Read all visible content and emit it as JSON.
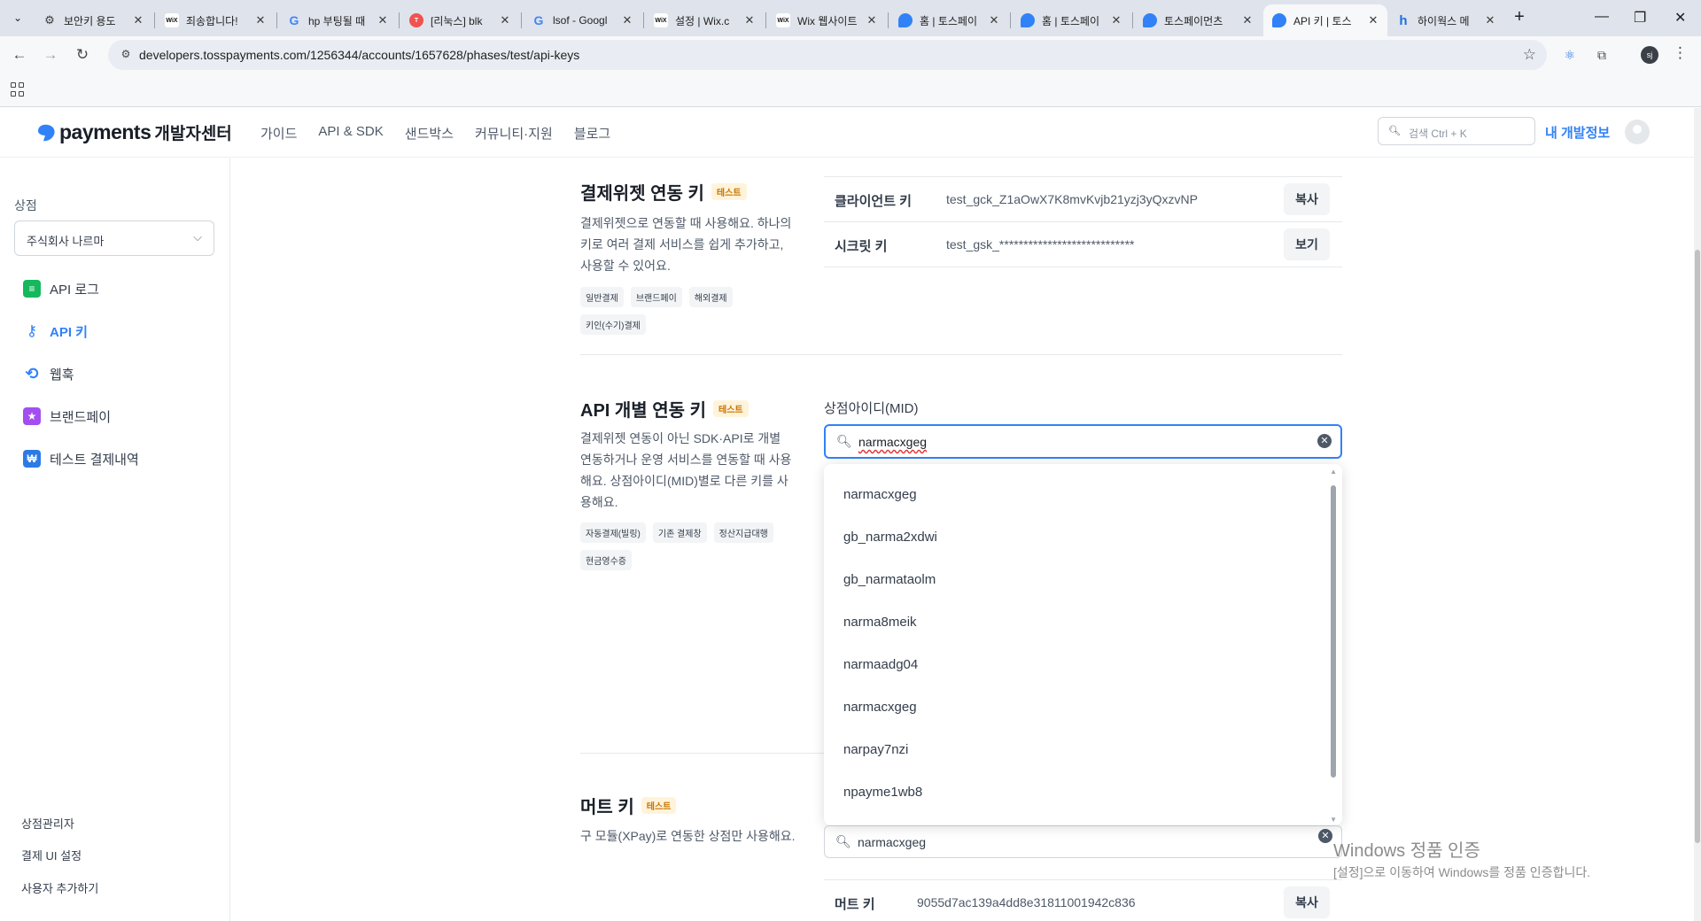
{
  "browser": {
    "tabs": [
      {
        "title": "보안키 용도",
        "icon": "gear-icon"
      },
      {
        "title": "죄송합니다!",
        "icon": "wix-icon"
      },
      {
        "title": "hp 부팅될 때",
        "icon": "google-icon"
      },
      {
        "title": "[리눅스] blk",
        "icon": "red-circle-icon"
      },
      {
        "title": "lsof - Googl",
        "icon": "google-icon"
      },
      {
        "title": "설정 | Wix.c",
        "icon": "wix-icon"
      },
      {
        "title": "Wix 웹사이트",
        "icon": "wix-icon"
      },
      {
        "title": "홈 | 토스페이",
        "icon": "toss-icon"
      },
      {
        "title": "홈 | 토스페이",
        "icon": "toss-icon"
      },
      {
        "title": "토스페이먼츠",
        "icon": "toss-icon"
      },
      {
        "title": "API 키 | 토스",
        "icon": "toss-icon"
      },
      {
        "title": "하이웍스 메",
        "icon": "hiworks-icon"
      }
    ],
    "active_tab_index": 10,
    "url": "developers.tosspayments.com/1256344/accounts/1657628/phases/test/api-keys",
    "profile_initials": "sj"
  },
  "header": {
    "logo_word": "payments",
    "logo_sub": "개발자센터",
    "nav": [
      "가이드",
      "API & SDK",
      "샌드박스",
      "커뮤니티·지원",
      "블로그"
    ],
    "search_placeholder": "검색 Ctrl + K",
    "my_dev": "내 개발정보"
  },
  "sidebar": {
    "store_label": "상점",
    "store_value": "주식회사 나르마",
    "items": [
      {
        "label": "API 로그",
        "icon": "document-icon",
        "color": "#15b85c"
      },
      {
        "label": "API 키",
        "icon": "key-icon",
        "color": "#3182f6",
        "active": true
      },
      {
        "label": "웹훅",
        "icon": "refresh-icon",
        "color": "#3182f6"
      },
      {
        "label": "브랜드페이",
        "icon": "brandpay-icon",
        "color": "#a34ef0"
      },
      {
        "label": "테스트 결제내역",
        "icon": "won-icon",
        "color": "#2c7be5"
      }
    ],
    "bottom_links": [
      "상점관리자",
      "결제 UI 설정",
      "사용자 추가하기"
    ]
  },
  "widget_section": {
    "title": "결제위젯 연동 키",
    "badge": "테스트",
    "description": "결제위젯으로 연동할 때 사용해요. 하나의 키로 여러 결제 서비스를 쉽게 추가하고, 사용할 수 있어요.",
    "tags": [
      "일반결제",
      "브랜드페이",
      "해외결제",
      "키인(수기)결제"
    ],
    "keys": [
      {
        "label": "클라이언트 키",
        "value": "test_gck_Z1aOwX7K8mvKvjb21yzj3yQxzvNP",
        "button": "복사"
      },
      {
        "label": "시크릿 키",
        "value": "test_gsk_****************************",
        "button": "보기"
      }
    ]
  },
  "api_section": {
    "title": "API 개별 연동 키",
    "badge": "테스트",
    "description": "결제위젯 연동이 아닌 SDK·API로 개별 연동하거나 운영 서비스를 연동할 때 사용해요. 상점아이디(MID)별로 다른 키를 사용해요.",
    "tags": [
      "자동결제(빌링)",
      "기존 결제창",
      "정산지급대행",
      "현금영수증"
    ],
    "mid_label": "상점아이디(MID)",
    "mid_value": "narmacxgeg",
    "dropdown_options": [
      "narmacxgeg",
      "gb_narma2xdwi",
      "gb_narmataolm",
      "narma8meik",
      "narmaadg04",
      "narmacxgeg",
      "narpay7nzi",
      "npayme1wb8"
    ]
  },
  "mute_section": {
    "title": "머트 키",
    "badge": "테스트",
    "description": "구 모듈(XPay)로 연동한 상점만 사용해요.",
    "mid_value": "narmacxgeg",
    "key_label": "머트 키",
    "key_value": "9055d7ac139a4dd8e31811001942c836",
    "button": "복사"
  },
  "watermark": {
    "line1": "Windows 정품 인증",
    "line2": "[설정]으로 이동하여 Windows를 정품 인증합니다."
  }
}
